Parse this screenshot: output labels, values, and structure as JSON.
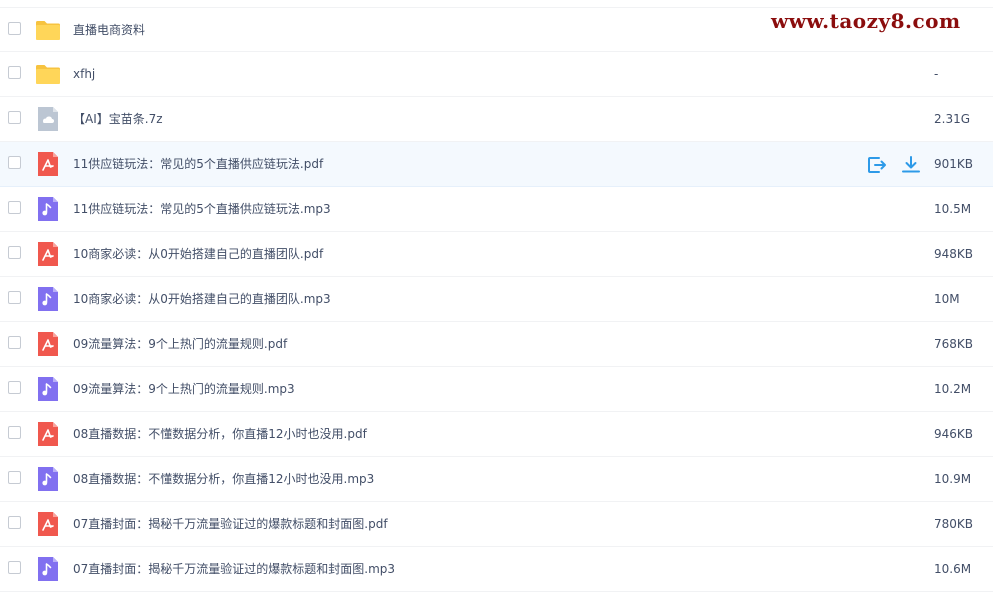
{
  "watermark": "www.taozy8.com",
  "files": [
    {
      "name": "直播电商资料",
      "size": "",
      "type": "folder"
    },
    {
      "name": "xfhj",
      "size": "-",
      "type": "folder"
    },
    {
      "name": "【AI】宝苗条.7z",
      "size": "2.31G",
      "type": "archive"
    },
    {
      "name": "11供应链玩法：常见的5个直播供应链玩法.pdf",
      "size": "901KB",
      "type": "pdf",
      "hovered": true
    },
    {
      "name": "11供应链玩法：常见的5个直播供应链玩法.mp3",
      "size": "10.5M",
      "type": "audio"
    },
    {
      "name": "10商家必读：从0开始搭建自己的直播团队.pdf",
      "size": "948KB",
      "type": "pdf"
    },
    {
      "name": "10商家必读：从0开始搭建自己的直播团队.mp3",
      "size": "10M",
      "type": "audio"
    },
    {
      "name": "09流量算法：9个上热门的流量规则.pdf",
      "size": "768KB",
      "type": "pdf"
    },
    {
      "name": "09流量算法：9个上热门的流量规则.mp3",
      "size": "10.2M",
      "type": "audio"
    },
    {
      "name": "08直播数据：不懂数据分析，你直播12小时也没用.pdf",
      "size": "946KB",
      "type": "pdf"
    },
    {
      "name": "08直播数据：不懂数据分析，你直播12小时也没用.mp3",
      "size": "10.9M",
      "type": "audio"
    },
    {
      "name": "07直播封面：揭秘千万流量验证过的爆款标题和封面图.pdf",
      "size": "780KB",
      "type": "pdf"
    },
    {
      "name": "07直播封面：揭秘千万流量验证过的爆款标题和封面图.mp3",
      "size": "10.6M",
      "type": "audio"
    }
  ],
  "colors": {
    "folder": "#ffd659",
    "pdf": "#f0584e",
    "audio": "#8170f0",
    "archive": "#bcc6d3",
    "action": "#2d9ae8",
    "watermark": "#8b0d0d"
  },
  "icons": {
    "folder": "folder-icon",
    "pdf": "pdf-icon",
    "audio": "audio-icon",
    "archive": "archive-icon",
    "share": "share-icon",
    "download": "download-icon"
  }
}
